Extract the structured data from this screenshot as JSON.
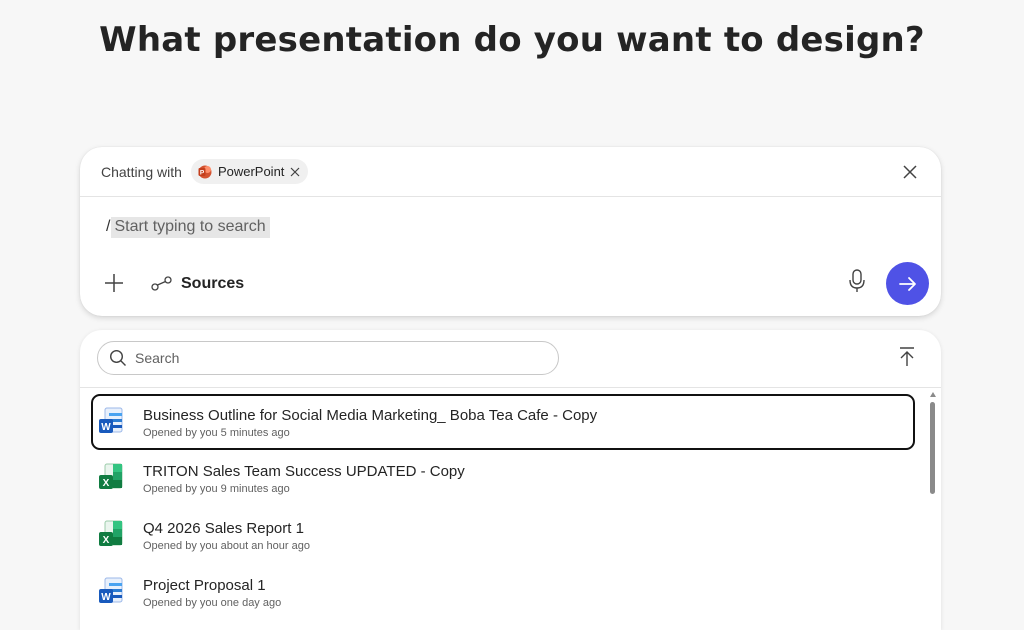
{
  "heading": "What presentation do you want to design?",
  "composer": {
    "chatting_label": "Chatting with",
    "chip_label": "PowerPoint",
    "chip_icon": "powerpoint-logo-icon",
    "slash": "/",
    "placeholder": "Start typing to search",
    "sources_label": "Sources",
    "send_color": "#4f52e6"
  },
  "files": {
    "search_placeholder": "Search",
    "items": [
      {
        "title": "Business Outline for Social Media Marketing_ Boba Tea Cafe - Copy",
        "meta": "Opened by you 5 minutes ago",
        "type": "word",
        "icon": "word-doc-icon"
      },
      {
        "title": "TRITON Sales Team Success UPDATED - Copy",
        "meta": "Opened by you 9 minutes ago",
        "type": "excel",
        "icon": "excel-sheet-icon"
      },
      {
        "title": "Q4 2026 Sales Report 1",
        "meta": "Opened by you about an hour ago",
        "type": "excel",
        "icon": "excel-sheet-icon"
      },
      {
        "title": "Project Proposal 1",
        "meta": "Opened by you one day ago",
        "type": "word",
        "icon": "word-doc-icon"
      }
    ]
  }
}
